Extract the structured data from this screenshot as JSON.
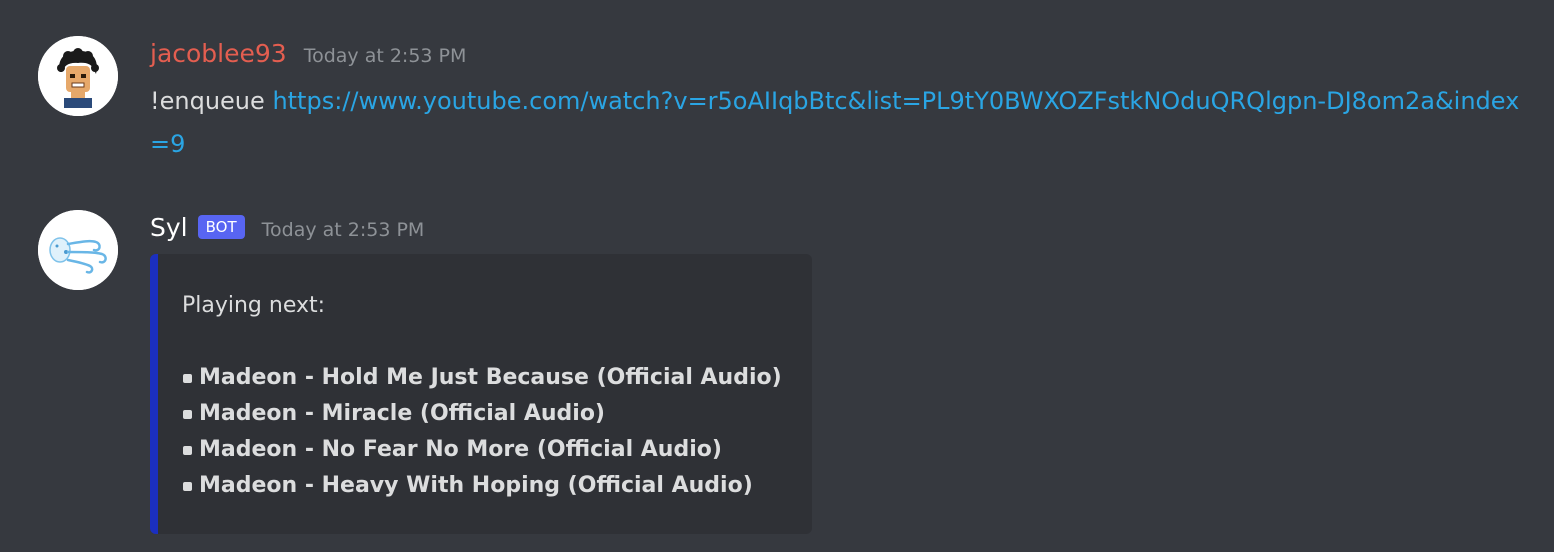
{
  "messages": [
    {
      "username": "jacoblee93",
      "timestamp": "Today at 2:53 PM",
      "command": "!enqueue",
      "link": "https://www.youtube.com/watch?v=r5oAIIqbBtc&list=PL9tY0BWXOZFstkNOduQRQlgpn-DJ8om2a&index=9"
    },
    {
      "username": "Syl",
      "bot_tag": "BOT",
      "timestamp": "Today at 2:53 PM",
      "embed": {
        "title": "Playing next:",
        "tracks": [
          "Madeon - Hold Me Just Because (Official Audio)",
          "Madeon - Miracle (Official Audio)",
          "Madeon - No Fear No More (Official Audio)",
          "Madeon - Heavy With Hoping (Official Audio)"
        ]
      }
    }
  ],
  "colors": {
    "background": "#36393f",
    "username_1": "#e45e50",
    "username_2": "#ffffff",
    "link": "#2aa5e4",
    "bot_tag": "#5865f2",
    "embed_bg": "#2f3136",
    "embed_border": "#1b2fbf"
  },
  "icons": {
    "avatar_1": "cartoon-person-avatar",
    "avatar_2": "wind-face-avatar"
  }
}
